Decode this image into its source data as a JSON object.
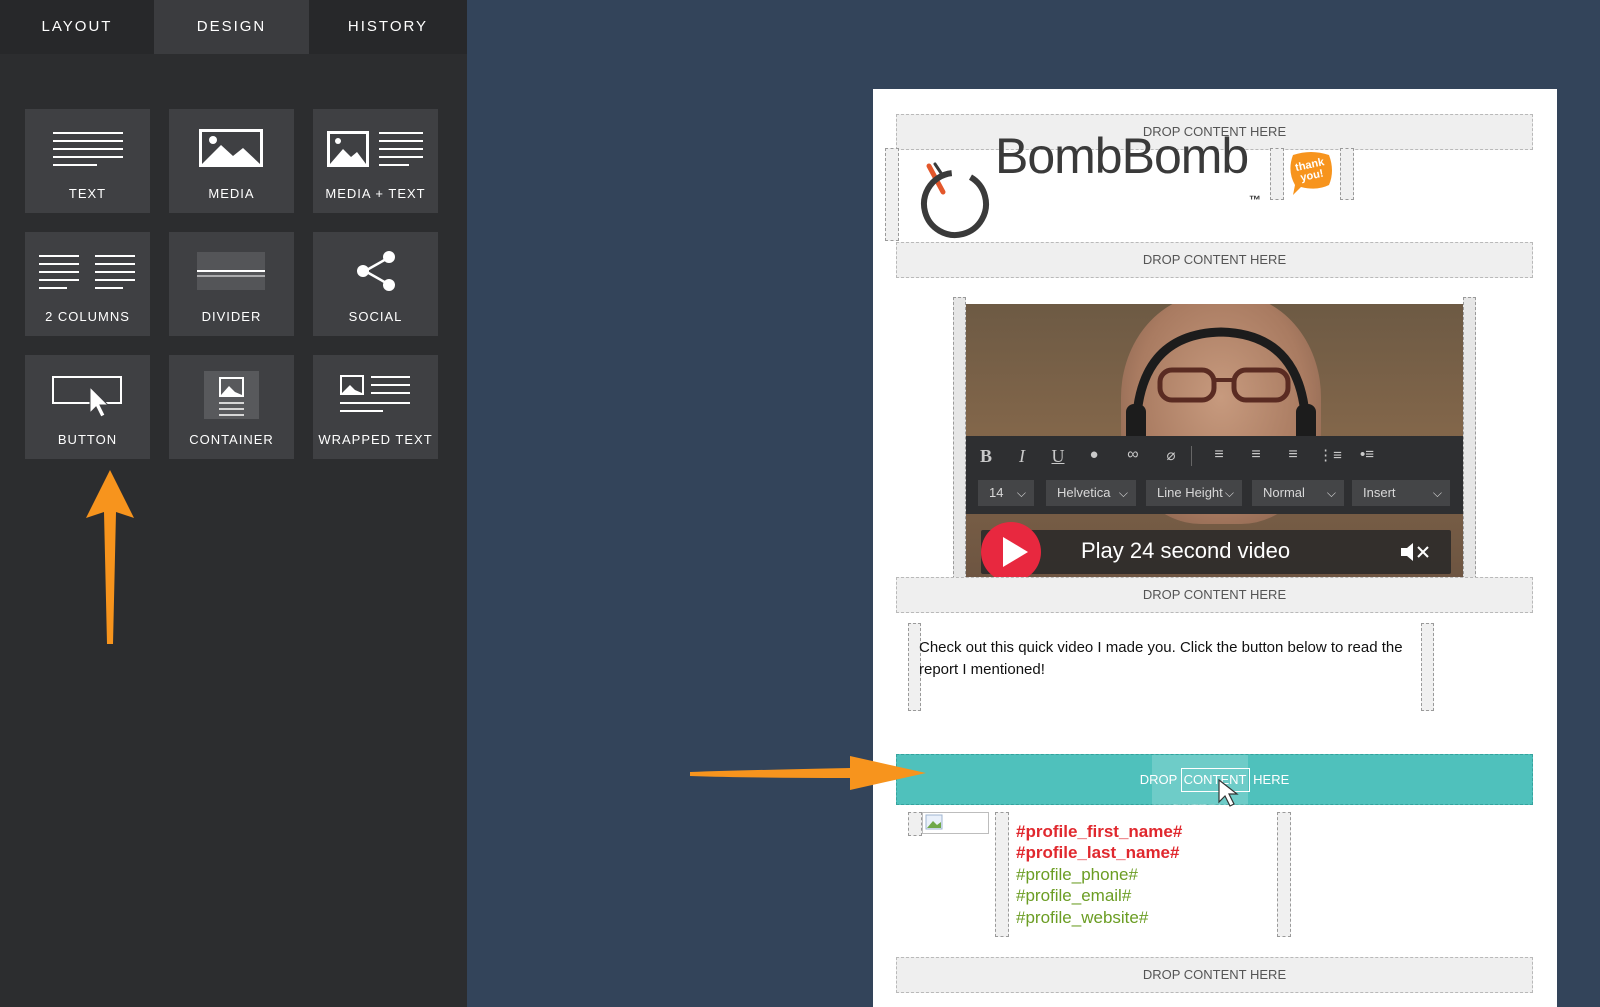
{
  "tabs": [
    "LAYOUT",
    "DESIGN",
    "HISTORY"
  ],
  "tiles": [
    {
      "label": "TEXT",
      "icon": "text-icon"
    },
    {
      "label": "MEDIA",
      "icon": "media-icon"
    },
    {
      "label": "MEDIA + TEXT",
      "icon": "media-text-icon"
    },
    {
      "label": "2 COLUMNS",
      "icon": "two-columns-icon"
    },
    {
      "label": "DIVIDER",
      "icon": "divider-icon"
    },
    {
      "label": "SOCIAL",
      "icon": "share-icon"
    },
    {
      "label": "BUTTON",
      "icon": "button-cursor-icon"
    },
    {
      "label": "CONTAINER",
      "icon": "container-icon"
    },
    {
      "label": "WRAPPED TEXT",
      "icon": "wrapped-text-icon"
    }
  ],
  "drop_zone_label": "DROP CONTENT HERE",
  "drop_zone_active_parts": [
    "DROP",
    "CONTENT",
    "HERE"
  ],
  "drag_ghost_label": "BUTTON",
  "brand": {
    "name": "BombBomb",
    "tm": "™",
    "sticker": "thank you!"
  },
  "editor_toolbar": {
    "font_size": "14",
    "font_family": "Helvetica",
    "line_height": "Line Height",
    "format": "Normal",
    "insert": "Insert"
  },
  "video": {
    "play_text": "Play 24 second video"
  },
  "body_text": "Check out this quick video I made you. Click the button below to read the report I mentioned!",
  "signature": {
    "first_name": "#profile_first_name#",
    "last_name": "#profile_last_name#",
    "phone": "#profile_phone#",
    "email": "#profile_email#",
    "website": "#profile_website#"
  },
  "colors": {
    "panel_bg": "#2c2d2f",
    "app_bg": "#33445a",
    "drop_active": "#4fc1bc",
    "arrow": "#f7941d",
    "play_red": "#e8283f",
    "name_red": "#e0282e",
    "contact_green": "#6b9d23"
  }
}
